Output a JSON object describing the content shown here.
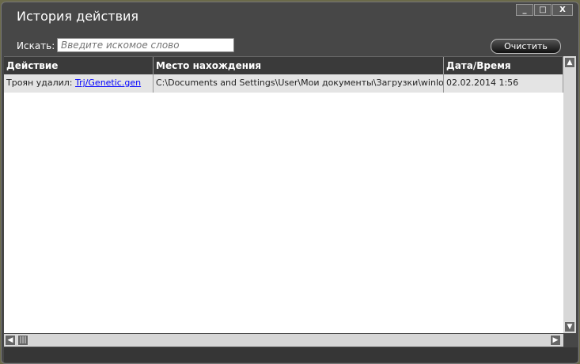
{
  "window": {
    "title": "История действия",
    "minimize": "_",
    "maximize": "□",
    "close": "X"
  },
  "search": {
    "label": "Искать:",
    "placeholder": "Введите искомое слово",
    "value": ""
  },
  "clear_button": "Очистить",
  "table": {
    "columns": [
      "Действие",
      "Место нахождения",
      "Дата/Время"
    ],
    "rows": [
      {
        "action_prefix": "Троян удалил:",
        "action_link": "Trj/Genetic.gen",
        "location": "C:\\Documents and Settings\\User\\Мои документы\\Загрузки\\winlock.exe",
        "datetime": "02.02.2014 1:56"
      }
    ]
  }
}
